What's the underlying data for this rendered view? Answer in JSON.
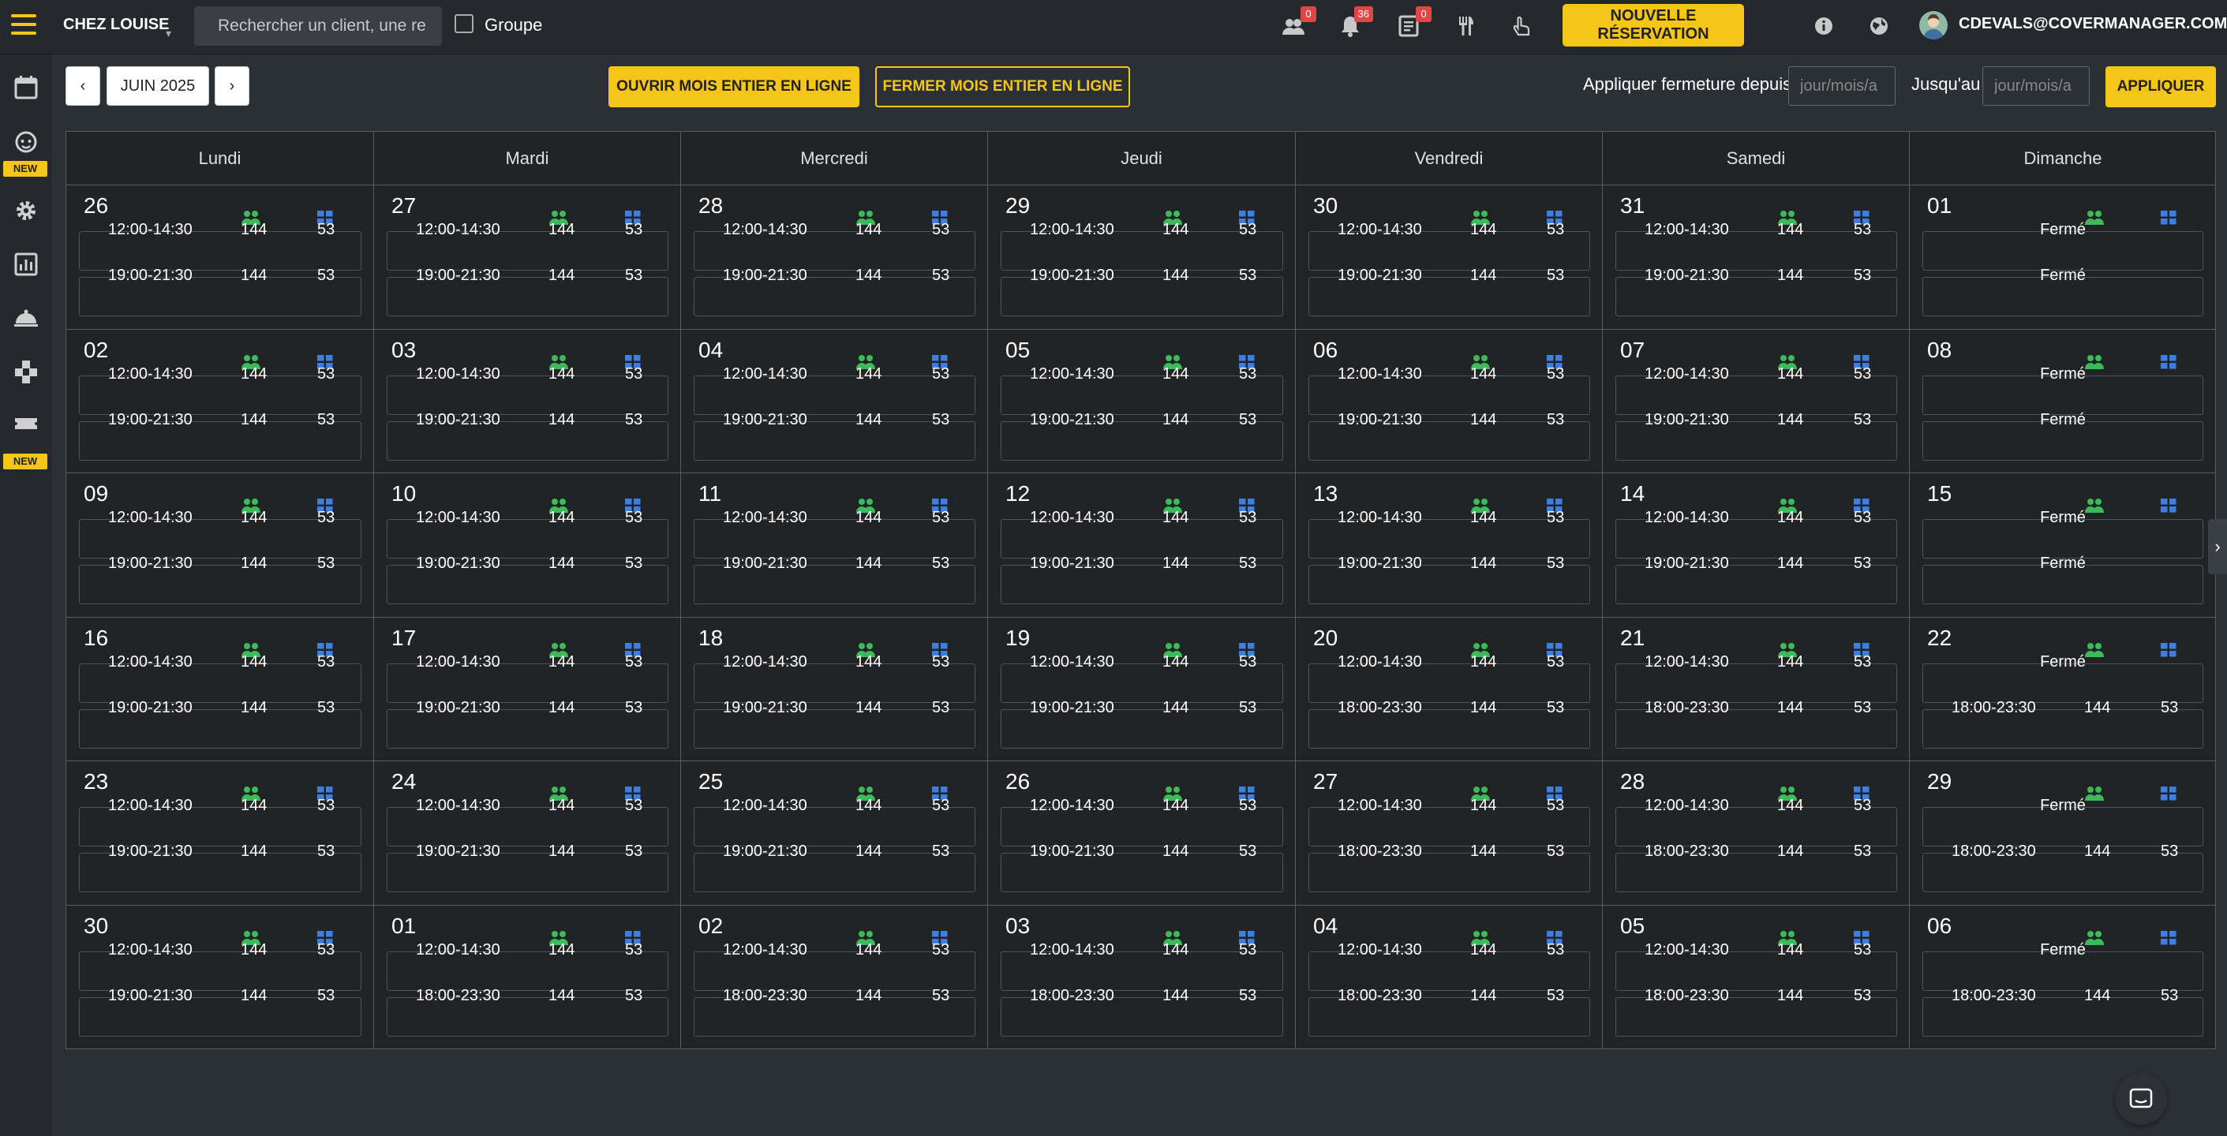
{
  "topbar": {
    "restaurant": "CHEZ LOUISE",
    "search_placeholder": "Rechercher un client, une re",
    "group_label": "Groupe",
    "badges": {
      "people": "0",
      "bell": "36",
      "list": "0"
    },
    "new_reservation": "NOUVELLE RÉSERVATION",
    "user_email": "CDEVALS@COVERMANAGER.COM"
  },
  "sidebar": {
    "new_tag": "NEW"
  },
  "controls": {
    "month": "JUIN 2025",
    "open_month": "OUVRIR MOIS ENTIER EN LIGNE",
    "close_month": "FERMER MOIS ENTIER EN LIGNE",
    "apply_from_label": "Appliquer fermeture depuis",
    "until_label": "Jusqu'au",
    "date_placeholder": "jour/mois/a",
    "apply": "APPLIQUER"
  },
  "colors": {
    "accent": "#f5c518",
    "people_icon": "#3dbb5a",
    "grid_icon": "#3d7fe0"
  },
  "calendar": {
    "weekdays": [
      "Lundi",
      "Mardi",
      "Mercredi",
      "Jeudi",
      "Vendredi",
      "Samedi",
      "Dimanche"
    ],
    "closed_label": "Fermé",
    "weeks": [
      [
        {
          "d": "26",
          "s": [
            {
              "t": "12:00-14:30",
              "a": "144",
              "b": "53"
            },
            {
              "t": "19:00-21:30",
              "a": "144",
              "b": "53"
            }
          ]
        },
        {
          "d": "27",
          "s": [
            {
              "t": "12:00-14:30",
              "a": "144",
              "b": "53"
            },
            {
              "t": "19:00-21:30",
              "a": "144",
              "b": "53"
            }
          ]
        },
        {
          "d": "28",
          "s": [
            {
              "t": "12:00-14:30",
              "a": "144",
              "b": "53"
            },
            {
              "t": "19:00-21:30",
              "a": "144",
              "b": "53"
            }
          ]
        },
        {
          "d": "29",
          "s": [
            {
              "t": "12:00-14:30",
              "a": "144",
              "b": "53"
            },
            {
              "t": "19:00-21:30",
              "a": "144",
              "b": "53"
            }
          ]
        },
        {
          "d": "30",
          "s": [
            {
              "t": "12:00-14:30",
              "a": "144",
              "b": "53"
            },
            {
              "t": "19:00-21:30",
              "a": "144",
              "b": "53"
            }
          ]
        },
        {
          "d": "31",
          "s": [
            {
              "t": "12:00-14:30",
              "a": "144",
              "b": "53"
            },
            {
              "t": "19:00-21:30",
              "a": "144",
              "b": "53"
            }
          ]
        },
        {
          "d": "01",
          "s": [
            {
              "closed": true
            },
            {
              "closed": true
            }
          ]
        }
      ],
      [
        {
          "d": "02",
          "s": [
            {
              "t": "12:00-14:30",
              "a": "144",
              "b": "53"
            },
            {
              "t": "19:00-21:30",
              "a": "144",
              "b": "53"
            }
          ]
        },
        {
          "d": "03",
          "s": [
            {
              "t": "12:00-14:30",
              "a": "144",
              "b": "53"
            },
            {
              "t": "19:00-21:30",
              "a": "144",
              "b": "53"
            }
          ]
        },
        {
          "d": "04",
          "s": [
            {
              "t": "12:00-14:30",
              "a": "144",
              "b": "53"
            },
            {
              "t": "19:00-21:30",
              "a": "144",
              "b": "53"
            }
          ]
        },
        {
          "d": "05",
          "s": [
            {
              "t": "12:00-14:30",
              "a": "144",
              "b": "53"
            },
            {
              "t": "19:00-21:30",
              "a": "144",
              "b": "53"
            }
          ]
        },
        {
          "d": "06",
          "s": [
            {
              "t": "12:00-14:30",
              "a": "144",
              "b": "53"
            },
            {
              "t": "19:00-21:30",
              "a": "144",
              "b": "53"
            }
          ]
        },
        {
          "d": "07",
          "s": [
            {
              "t": "12:00-14:30",
              "a": "144",
              "b": "53"
            },
            {
              "t": "19:00-21:30",
              "a": "144",
              "b": "53"
            }
          ]
        },
        {
          "d": "08",
          "s": [
            {
              "closed": true
            },
            {
              "closed": true
            }
          ]
        }
      ],
      [
        {
          "d": "09",
          "s": [
            {
              "t": "12:00-14:30",
              "a": "144",
              "b": "53"
            },
            {
              "t": "19:00-21:30",
              "a": "144",
              "b": "53"
            }
          ]
        },
        {
          "d": "10",
          "s": [
            {
              "t": "12:00-14:30",
              "a": "144",
              "b": "53"
            },
            {
              "t": "19:00-21:30",
              "a": "144",
              "b": "53"
            }
          ]
        },
        {
          "d": "11",
          "s": [
            {
              "t": "12:00-14:30",
              "a": "144",
              "b": "53"
            },
            {
              "t": "19:00-21:30",
              "a": "144",
              "b": "53"
            }
          ]
        },
        {
          "d": "12",
          "s": [
            {
              "t": "12:00-14:30",
              "a": "144",
              "b": "53"
            },
            {
              "t": "19:00-21:30",
              "a": "144",
              "b": "53"
            }
          ]
        },
        {
          "d": "13",
          "s": [
            {
              "t": "12:00-14:30",
              "a": "144",
              "b": "53"
            },
            {
              "t": "19:00-21:30",
              "a": "144",
              "b": "53"
            }
          ]
        },
        {
          "d": "14",
          "s": [
            {
              "t": "12:00-14:30",
              "a": "144",
              "b": "53"
            },
            {
              "t": "19:00-21:30",
              "a": "144",
              "b": "53"
            }
          ]
        },
        {
          "d": "15",
          "s": [
            {
              "closed": true
            },
            {
              "closed": true
            }
          ]
        }
      ],
      [
        {
          "d": "16",
          "s": [
            {
              "t": "12:00-14:30",
              "a": "144",
              "b": "53"
            },
            {
              "t": "19:00-21:30",
              "a": "144",
              "b": "53"
            }
          ]
        },
        {
          "d": "17",
          "s": [
            {
              "t": "12:00-14:30",
              "a": "144",
              "b": "53"
            },
            {
              "t": "19:00-21:30",
              "a": "144",
              "b": "53"
            }
          ]
        },
        {
          "d": "18",
          "s": [
            {
              "t": "12:00-14:30",
              "a": "144",
              "b": "53"
            },
            {
              "t": "19:00-21:30",
              "a": "144",
              "b": "53"
            }
          ]
        },
        {
          "d": "19",
          "s": [
            {
              "t": "12:00-14:30",
              "a": "144",
              "b": "53"
            },
            {
              "t": "19:00-21:30",
              "a": "144",
              "b": "53"
            }
          ]
        },
        {
          "d": "20",
          "s": [
            {
              "t": "12:00-14:30",
              "a": "144",
              "b": "53"
            },
            {
              "t": "18:00-23:30",
              "a": "144",
              "b": "53"
            }
          ]
        },
        {
          "d": "21",
          "s": [
            {
              "t": "12:00-14:30",
              "a": "144",
              "b": "53"
            },
            {
              "t": "18:00-23:30",
              "a": "144",
              "b": "53"
            }
          ]
        },
        {
          "d": "22",
          "s": [
            {
              "closed": true
            },
            {
              "t": "18:00-23:30",
              "a": "144",
              "b": "53"
            }
          ]
        }
      ],
      [
        {
          "d": "23",
          "s": [
            {
              "t": "12:00-14:30",
              "a": "144",
              "b": "53"
            },
            {
              "t": "19:00-21:30",
              "a": "144",
              "b": "53"
            }
          ]
        },
        {
          "d": "24",
          "s": [
            {
              "t": "12:00-14:30",
              "a": "144",
              "b": "53"
            },
            {
              "t": "19:00-21:30",
              "a": "144",
              "b": "53"
            }
          ]
        },
        {
          "d": "25",
          "s": [
            {
              "t": "12:00-14:30",
              "a": "144",
              "b": "53"
            },
            {
              "t": "19:00-21:30",
              "a": "144",
              "b": "53"
            }
          ]
        },
        {
          "d": "26",
          "s": [
            {
              "t": "12:00-14:30",
              "a": "144",
              "b": "53"
            },
            {
              "t": "19:00-21:30",
              "a": "144",
              "b": "53"
            }
          ]
        },
        {
          "d": "27",
          "s": [
            {
              "t": "12:00-14:30",
              "a": "144",
              "b": "53"
            },
            {
              "t": "18:00-23:30",
              "a": "144",
              "b": "53"
            }
          ]
        },
        {
          "d": "28",
          "s": [
            {
              "t": "12:00-14:30",
              "a": "144",
              "b": "53"
            },
            {
              "t": "18:00-23:30",
              "a": "144",
              "b": "53"
            }
          ]
        },
        {
          "d": "29",
          "s": [
            {
              "closed": true
            },
            {
              "t": "18:00-23:30",
              "a": "144",
              "b": "53"
            }
          ]
        }
      ],
      [
        {
          "d": "30",
          "s": [
            {
              "t": "12:00-14:30",
              "a": "144",
              "b": "53"
            },
            {
              "t": "19:00-21:30",
              "a": "144",
              "b": "53"
            }
          ]
        },
        {
          "d": "01",
          "s": [
            {
              "t": "12:00-14:30",
              "a": "144",
              "b": "53"
            },
            {
              "t": "18:00-23:30",
              "a": "144",
              "b": "53"
            }
          ]
        },
        {
          "d": "02",
          "s": [
            {
              "t": "12:00-14:30",
              "a": "144",
              "b": "53"
            },
            {
              "t": "18:00-23:30",
              "a": "144",
              "b": "53"
            }
          ]
        },
        {
          "d": "03",
          "s": [
            {
              "t": "12:00-14:30",
              "a": "144",
              "b": "53"
            },
            {
              "t": "18:00-23:30",
              "a": "144",
              "b": "53"
            }
          ]
        },
        {
          "d": "04",
          "s": [
            {
              "t": "12:00-14:30",
              "a": "144",
              "b": "53"
            },
            {
              "t": "18:00-23:30",
              "a": "144",
              "b": "53"
            }
          ]
        },
        {
          "d": "05",
          "s": [
            {
              "t": "12:00-14:30",
              "a": "144",
              "b": "53"
            },
            {
              "t": "18:00-23:30",
              "a": "144",
              "b": "53"
            }
          ]
        },
        {
          "d": "06",
          "s": [
            {
              "closed": true
            },
            {
              "t": "18:00-23:30",
              "a": "144",
              "b": "53"
            }
          ]
        }
      ]
    ]
  }
}
